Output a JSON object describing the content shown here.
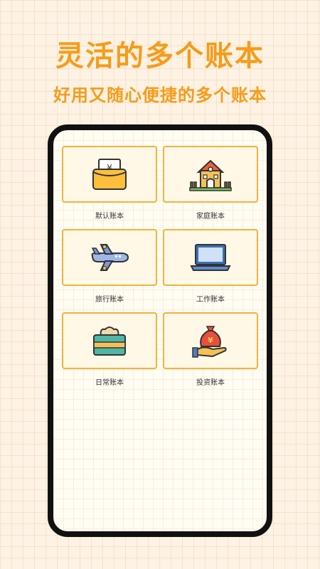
{
  "headline": "灵活的多个账本",
  "subline": "好用又随心便捷的多个账本",
  "books": [
    {
      "label": "默认账本",
      "icon": "wallet-icon"
    },
    {
      "label": "家庭账本",
      "icon": "house-icon"
    },
    {
      "label": "旅行账本",
      "icon": "airplane-icon"
    },
    {
      "label": "工作账本",
      "icon": "laptop-icon"
    },
    {
      "label": "日常账本",
      "icon": "tissue-box-icon"
    },
    {
      "label": "投资账本",
      "icon": "money-bag-hand-icon"
    }
  ],
  "wallet_symbol": "¥",
  "bag_symbol": "¥",
  "colors": {
    "accent": "#f59c1a",
    "card_border": "#f4b23d",
    "card_bg": "#fff8e6",
    "page_bg": "#fdf2e3"
  }
}
